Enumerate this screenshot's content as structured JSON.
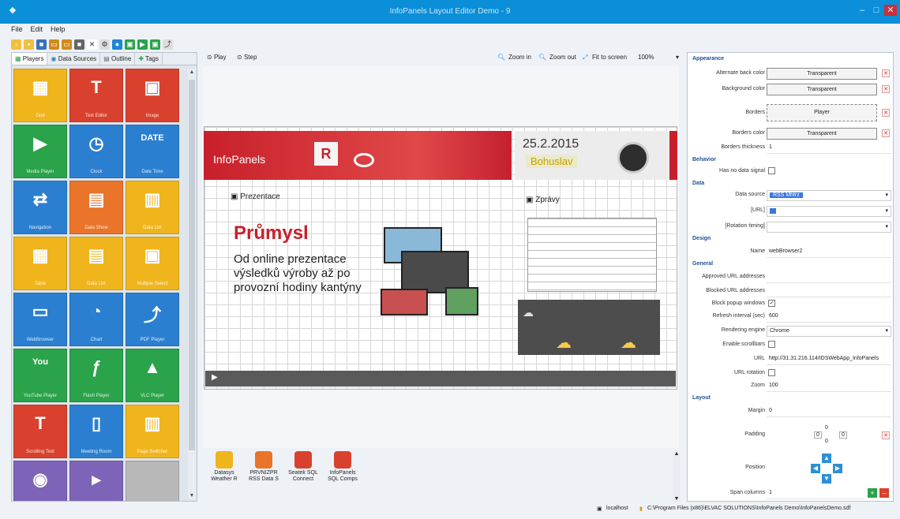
{
  "window": {
    "title": "InfoPanels Layout Editor Demo - 9"
  },
  "menu": [
    "File",
    "Edit",
    "Help"
  ],
  "left_tabs": [
    "Players",
    "Data Sources",
    "Outline",
    "Tags"
  ],
  "tiles": [
    {
      "label": "Grid",
      "icon": "grid-icon",
      "color": "#f0b51c",
      "glyph": "▦"
    },
    {
      "label": "Text Editor",
      "icon": "text-icon",
      "color": "#d9412e",
      "glyph": "T"
    },
    {
      "label": "Image",
      "icon": "image-icon",
      "color": "#d9412e",
      "glyph": "▣"
    },
    {
      "label": "Media Player",
      "icon": "play-circle-icon",
      "color": "#2aa34a",
      "glyph": "▶"
    },
    {
      "label": "Clock",
      "icon": "clock-icon",
      "color": "#2b7fd0",
      "glyph": "◷"
    },
    {
      "label": "Date Time",
      "icon": "date-icon",
      "color": "#2b7fd0",
      "glyph": "DATE"
    },
    {
      "label": "Navigation",
      "icon": "navigation-icon",
      "color": "#2b7fd0",
      "glyph": "⇄"
    },
    {
      "label": "Data Show",
      "icon": "data-show-icon",
      "color": "#e9742a",
      "glyph": "▤"
    },
    {
      "label": "Data List",
      "icon": "data-list-icon",
      "color": "#f0b51c",
      "glyph": "▥"
    },
    {
      "label": "Table",
      "icon": "table-icon",
      "color": "#f0b51c",
      "glyph": "▦"
    },
    {
      "label": "Data List",
      "icon": "data-list-2-icon",
      "color": "#f0b51c",
      "glyph": "▤"
    },
    {
      "label": "Multiple Select",
      "icon": "multi-select-icon",
      "color": "#f0b51c",
      "glyph": "▣"
    },
    {
      "label": "WebBrowser",
      "icon": "web-browser-icon",
      "color": "#2b7fd0",
      "glyph": "▭"
    },
    {
      "label": "Chart",
      "icon": "chart-icon",
      "color": "#2b7fd0",
      "glyph": "◔"
    },
    {
      "label": "PDF Player",
      "icon": "pdf-icon",
      "color": "#2b7fd0",
      "glyph": "⤴"
    },
    {
      "label": "YouTube Player",
      "icon": "youtube-icon",
      "color": "#2aa34a",
      "glyph": "You"
    },
    {
      "label": "Flash Player",
      "icon": "flash-icon",
      "color": "#2aa34a",
      "glyph": "ƒ"
    },
    {
      "label": "VLC Player",
      "icon": "vlc-icon",
      "color": "#2aa34a",
      "glyph": "▲"
    },
    {
      "label": "Scrolling Text",
      "icon": "scrolling-text-icon",
      "color": "#d9412e",
      "glyph": "T"
    },
    {
      "label": "Meeting Room",
      "icon": "meeting-room-icon",
      "color": "#2b7fd0",
      "glyph": "▯"
    },
    {
      "label": "Page Switcher",
      "icon": "page-switcher-icon",
      "color": "#f0b51c",
      "glyph": "▥"
    },
    {
      "label": "",
      "icon": "eye-icon",
      "color": "#7e64b8",
      "glyph": "◉"
    },
    {
      "label": "",
      "icon": "cursor-icon",
      "color": "#7e64b8",
      "glyph": "▸"
    },
    {
      "label": "",
      "icon": "empty-icon",
      "color": "#b8b8b8",
      "glyph": ""
    }
  ],
  "center_toolbar": {
    "play": "Play",
    "step": "Step",
    "zoom_in": "Zoom in",
    "zoom_out": "Zoom out",
    "fit": "Fit to screen",
    "zoom_level": "100%"
  },
  "layout": {
    "logo": "InfoPanels",
    "date": "25.2.2015",
    "city": "Bohuslav",
    "prez_header": "Prezentace",
    "headline": "Průmysl",
    "body_text": "Od online prezentace výsledků výroby až po provozní hodiny kantýny",
    "news_header": "Zprávy"
  },
  "data_sources": [
    {
      "label": "Datasys Weather R",
      "color": "#f0b51c"
    },
    {
      "label": "PRVNIZPR RSS Data S",
      "color": "#e9742a"
    },
    {
      "label": "Seatek SQL Connect",
      "color": "#d9412e"
    },
    {
      "label": "InfoPanels SQL Comps",
      "color": "#d9412e"
    }
  ],
  "properties": {
    "appearance": "Appearance",
    "alt_back_color_label": "Alternate back color",
    "alt_back_color": "Transparent",
    "bg_color_label": "Background color",
    "bg_color": "Transparent",
    "borders_label": "Borders",
    "borders": "Player",
    "borders_color_label": "Borders color",
    "borders_color": "Transparent",
    "borders_thickness_label": "Borders thickness",
    "borders_thickness": "1",
    "behavior": "Behavior",
    "has_no_data_signal_label": "Has no data signal",
    "data": "Data",
    "data_source_label": "Data source",
    "data_source": "RSS Mhfrz",
    "url_label": "[URL]",
    "rotation_label": "[Rotation timing]",
    "design": "Design",
    "name_label": "Name",
    "name": "webBrowser2",
    "general": "General",
    "approved_label": "Approved URL addresses",
    "blocked_label": "Blocked URL addresses",
    "block_popup_label": "Block popup windows",
    "refresh_label": "Refresh interval (sec)",
    "refresh": "600",
    "rendering_label": "Rendering engine",
    "rendering": "Chrome",
    "scrollbars_label": "Enable scrollbars",
    "url2_label": "URL",
    "url2": "http://31.31.216.114/IDSWebApp_InfoPanels",
    "url_rotation_label": "URL rotation",
    "zoom_label": "Zoom",
    "zoom": "100",
    "layout": "Layout",
    "margin_label": "Margin",
    "margin": "0",
    "padding_label": "Padding",
    "padding": "0",
    "position_label": "Position",
    "span_columns_label": "Span columns",
    "span_columns": "1"
  },
  "status": {
    "server": "localhost",
    "path": "C:\\Program Files (x86)\\ELVAC SOLUTIONS\\InfoPanels Demo\\InfoPanelsDemo.sdf"
  }
}
